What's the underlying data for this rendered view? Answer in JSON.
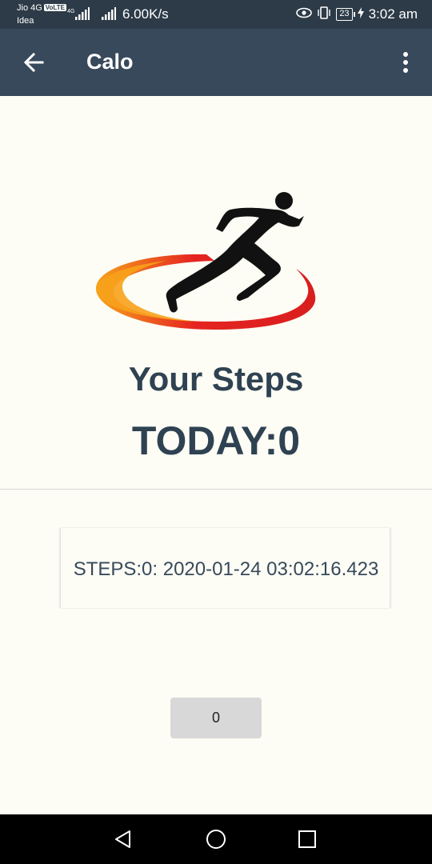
{
  "status_bar": {
    "carrier_1": "Jio 4G",
    "volte": "VoLTE",
    "network_type": "4G",
    "carrier_2": "Idea",
    "net_speed": "6.00K/s",
    "battery": "23",
    "time": "3:02 am"
  },
  "app_bar": {
    "title": "Calo"
  },
  "main": {
    "steps_title": "Your Steps",
    "today_label": "TODAY:0"
  },
  "records": [
    {
      "text": "STEPS:0: 2020-01-24 03:02:16.423"
    }
  ],
  "count_button": {
    "label": "0"
  },
  "colors": {
    "app_bar": "#37495a",
    "status_bar": "#2d3b48",
    "text_primary": "#2f4252",
    "background": "#fdfdf5",
    "logo_red": "#e52421",
    "logo_orange": "#f7a21b"
  },
  "icons": {
    "back": "arrow-left-icon",
    "menu": "more-vert-icon",
    "logo": "runner-logo",
    "nav_back": "triangle-back-icon",
    "nav_home": "circle-home-icon",
    "nav_recents": "square-recents-icon"
  }
}
